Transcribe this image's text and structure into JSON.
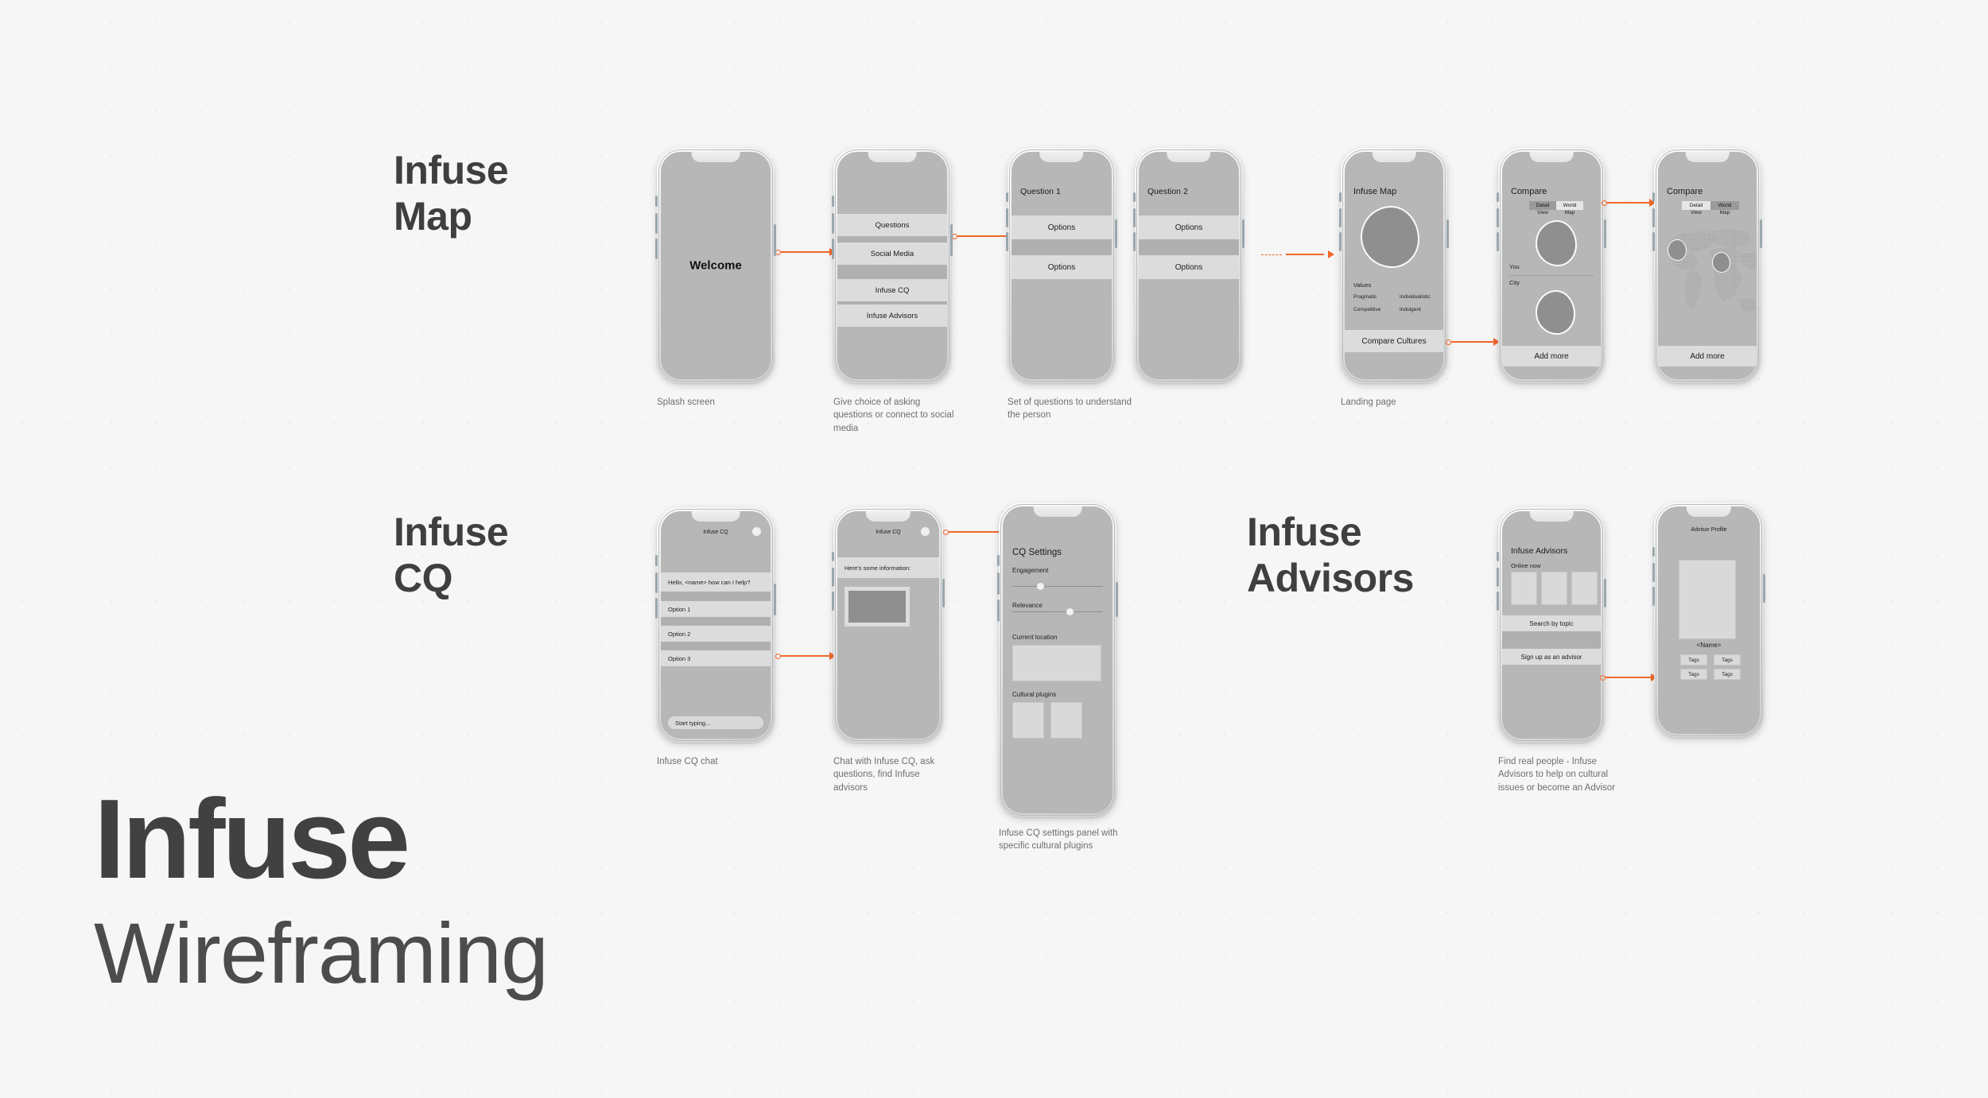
{
  "poster": {
    "title_line1": "Infuse",
    "title_line2": "Wireframing",
    "background_color": "#f6f6f6",
    "accent_color": "#f2682a"
  },
  "sections": [
    {
      "id": "infuse-map",
      "heading": "Infuse\nMap"
    },
    {
      "id": "infuse-cq",
      "heading": "Infuse\nCQ"
    },
    {
      "id": "infuse-advisors",
      "heading": "Infuse\nAdvisors"
    }
  ],
  "screens": {
    "splash": {
      "welcome": "Welcome",
      "caption": "Splash screen"
    },
    "choice": {
      "items": [
        "Questions",
        "Social Media",
        "Infuse CQ",
        "Infuse Advisors"
      ],
      "caption": "Give choice of asking\nquestions or connect to social\nmedia"
    },
    "question1": {
      "title": "Question 1",
      "option_a": "Options",
      "option_b": "Options",
      "caption": "Set of questions to understand\nthe person"
    },
    "question2": {
      "title": "Question 2",
      "option_a": "Options",
      "option_b": "Options"
    },
    "map_landing": {
      "title": "Infuse Map",
      "values_label": "Values",
      "values": [
        "Pragmatic",
        "Individualistic",
        "Competitive",
        "Indulgent"
      ],
      "cta": "Compare Cultures",
      "caption": "Landing page"
    },
    "compare_detail": {
      "title": "Compare",
      "seg_left_line1": "Detail",
      "seg_left_line2": "View",
      "seg_right_line1": "World",
      "seg_right_line2": "Map",
      "row_you": "You",
      "row_city": "City",
      "cta": "Add more"
    },
    "compare_world": {
      "title": "Compare",
      "seg_left_line1": "Detail",
      "seg_left_line2": "View",
      "seg_right_line1": "World",
      "seg_right_line2": "Map",
      "cta": "Add more"
    },
    "cq_chat": {
      "title": "Infuse CQ",
      "greeting": "Hello, <name> how can I help?",
      "options": [
        "Option 1",
        "Option 2",
        "Option 3"
      ],
      "input_placeholder": "Start typing...",
      "caption": "Infuse CQ chat"
    },
    "cq_info": {
      "title": "Infuse CQ",
      "message": "Here's some information:",
      "caption": "Chat with Infuse CQ, ask\nquestions, find Infuse\nadvisors"
    },
    "cq_settings": {
      "title": "CQ Settings",
      "slider1_label": "Engagement",
      "slider1_value": 40,
      "slider2_label": "Relevance",
      "slider2_value": 68,
      "location_label": "Current location",
      "plugins_label": "Cultural plugins",
      "caption": "Infuse CQ settings panel with\nspecific cultural plugins"
    },
    "advisors_list": {
      "title": "Infuse Advisors",
      "online_label": "Online now",
      "search_cta": "Search by topic",
      "signup_cta": "Sign up as an advisor",
      "caption": "Find real people - Infuse\nAdvisors to help on cultural\nissues or become an Advisor"
    },
    "advisor_profile": {
      "title": "Advisor Profile",
      "name": "<Name>",
      "tags": [
        "Tags",
        "Tags",
        "Tags",
        "Tags"
      ]
    }
  }
}
